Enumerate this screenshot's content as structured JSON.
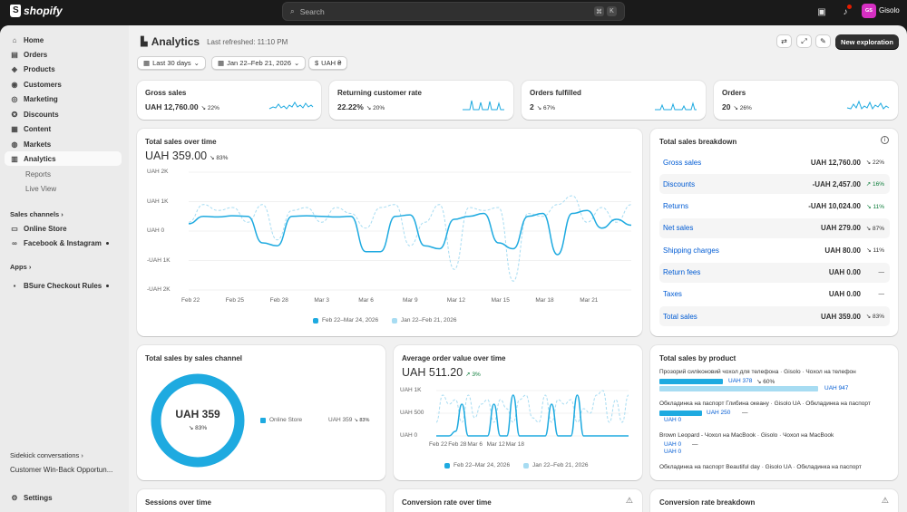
{
  "topbar": {
    "brand": "shopify",
    "search_placeholder": "Search",
    "kbd1": "⌘",
    "kbd2": "K",
    "avatar_initials": "GS",
    "store": "Gisolo",
    "notification_count": "1"
  },
  "sidebar": {
    "items": [
      {
        "label": "Home",
        "icon": "home-icon"
      },
      {
        "label": "Orders",
        "icon": "orders-icon"
      },
      {
        "label": "Products",
        "icon": "tag-icon"
      },
      {
        "label": "Customers",
        "icon": "person-icon"
      },
      {
        "label": "Marketing",
        "icon": "target-icon"
      },
      {
        "label": "Discounts",
        "icon": "discount-icon"
      },
      {
        "label": "Content",
        "icon": "content-icon"
      },
      {
        "label": "Markets",
        "icon": "globe-icon"
      },
      {
        "label": "Analytics",
        "icon": "chart-icon"
      }
    ],
    "sub_items": [
      "Reports",
      "Live View"
    ],
    "sales_channels_label": "Sales channels",
    "channels": [
      "Online Store",
      "Facebook & Instagram"
    ],
    "apps_label": "Apps",
    "apps": [
      "BSure Checkout Rules"
    ],
    "sidekick_label": "Sidekick conversations",
    "sidekick_item": "Customer Win-Back Opportun...",
    "settings": "Settings"
  },
  "header": {
    "title": "Analytics",
    "refreshed": "Last refreshed: 11:10 PM",
    "new_exploration": "New exploration"
  },
  "filters": {
    "range": "Last 30 days",
    "dates": "Jan 22–Feb 21, 2026",
    "currency": "UAH ₴"
  },
  "kpis": [
    {
      "title": "Gross sales",
      "value": "UAH 12,760.00",
      "pct": "↘ 22%"
    },
    {
      "title": "Returning customer rate",
      "value": "22.22%",
      "pct": "↘ 20%"
    },
    {
      "title": "Orders fulfilled",
      "value": "2",
      "pct": "↘ 67%"
    },
    {
      "title": "Orders",
      "value": "20",
      "pct": "↘ 26%"
    }
  ],
  "total_sales_chart": {
    "title": "Total sales over time",
    "value": "UAH 359.00",
    "pct": "↘ 83%",
    "legend": [
      "Feb 22–Mar 24, 2026",
      "Jan 22–Feb 21, 2026"
    ]
  },
  "chart_data": [
    {
      "type": "line",
      "title": "Total sales over time",
      "y_ticks": [
        "UAH 2K",
        "UAH 1K",
        "UAH 0",
        "-UAH 1K",
        "-UAH 2K"
      ],
      "x_ticks": [
        "Feb 22",
        "Feb 25",
        "Feb 28",
        "Mar 3",
        "Mar 6",
        "Mar 9",
        "Mar 12",
        "Mar 15",
        "Mar 18",
        "Mar 21"
      ],
      "ylim": [
        -2000,
        2000
      ],
      "series": [
        {
          "name": "Feb 22–Mar 24, 2026",
          "values": [
            250,
            500,
            480,
            520,
            500,
            -400,
            -500,
            500,
            520,
            500,
            480,
            500,
            -700,
            -700,
            500,
            550,
            -500,
            -600,
            400,
            500,
            600,
            -400,
            -600,
            500,
            600,
            -800,
            600,
            700,
            100,
            400,
            200
          ]
        },
        {
          "name": "Jan 22–Feb 21, 2026",
          "values": [
            300,
            900,
            700,
            800,
            300,
            900,
            -300,
            700,
            800,
            300,
            800,
            600,
            100,
            800,
            900,
            -500,
            300,
            900,
            -1300,
            800,
            700,
            800,
            -1700,
            600,
            500,
            900,
            1200,
            300,
            800,
            300,
            900
          ]
        }
      ]
    },
    {
      "type": "line",
      "title": "Average order value over time",
      "y_ticks": [
        "UAH 1K",
        "UAH 500",
        "UAH 0"
      ],
      "x_ticks": [
        "Feb 22",
        "Feb 28",
        "Mar 6",
        "Mar 12",
        "Mar 18"
      ],
      "ylim": [
        0,
        1000
      ],
      "series": [
        {
          "name": "Feb 22–Mar 24, 2026",
          "values": [
            0,
            0,
            0,
            100,
            700,
            0,
            0,
            0,
            0,
            700,
            0,
            0,
            900,
            0,
            0,
            0,
            0,
            0,
            700,
            0,
            0,
            0,
            900,
            0,
            0,
            0,
            0,
            0,
            0,
            0,
            0
          ]
        },
        {
          "name": "Jan 22–Feb 21, 2026",
          "values": [
            300,
            900,
            700,
            800,
            300,
            900,
            400,
            700,
            800,
            300,
            800,
            600,
            300,
            800,
            900,
            400,
            300,
            900,
            300,
            800,
            700,
            800,
            300,
            600,
            500,
            900,
            1000,
            300,
            800,
            300,
            900
          ]
        }
      ]
    },
    {
      "type": "pie",
      "title": "Total sales by sales channel",
      "center_value": "UAH 359",
      "center_pct": "↘ 83%",
      "series": [
        {
          "name": "Online Store",
          "values": [
            359
          ]
        }
      ]
    }
  ],
  "breakdown": {
    "title": "Total sales breakdown",
    "rows": [
      {
        "label": "Gross sales",
        "value": "UAH 12,760.00",
        "pct": "↘ 22%",
        "pct_color": "#303030"
      },
      {
        "label": "Discounts",
        "value": "-UAH 2,457.00",
        "pct": "↗ 16%",
        "pct_color": "#0c7d3a"
      },
      {
        "label": "Returns",
        "value": "-UAH 10,024.00",
        "pct": "↘ 11%",
        "pct_color": "#0c7d3a"
      },
      {
        "label": "Net sales",
        "value": "UAH 279.00",
        "pct": "↘ 87%",
        "pct_color": "#303030"
      },
      {
        "label": "Shipping charges",
        "value": "UAH 80.00",
        "pct": "↘ 11%",
        "pct_color": "#303030"
      },
      {
        "label": "Return fees",
        "value": "UAH 0.00",
        "pct": "—",
        "pct_color": "#303030"
      },
      {
        "label": "Taxes",
        "value": "UAH 0.00",
        "pct": "—",
        "pct_color": "#303030"
      },
      {
        "label": "Total sales",
        "value": "UAH 359.00",
        "pct": "↘ 83%",
        "pct_color": "#303030"
      }
    ]
  },
  "channel_card": {
    "title": "Total sales by sales channel",
    "center": "UAH 359",
    "center_pct": "↘ 83%",
    "legend_label": "Online Store",
    "legend_value": "UAH 359",
    "legend_pct": "↘ 83%"
  },
  "aov_card": {
    "title": "Average order value over time",
    "value": "UAH 511.20",
    "pct": "↗ 3%",
    "legend": [
      "Feb 22–Mar 24, 2026",
      "Jan 22–Feb 21, 2026"
    ]
  },
  "product_card": {
    "title": "Total sales by product",
    "products": [
      {
        "name": "Прозорий силіконовий чохол для телефона · Gisolo · Чохол на телефон",
        "cur": "UAH 378",
        "pct": "↘ 60%",
        "prev": "UAH 947",
        "cur_frac": 0.265,
        "prev_frac": 0.66
      },
      {
        "name": "Обкладинка на паспорт Глибина океану · Gisolo UA · Обкладинка на паспорт",
        "cur": "UAH 250",
        "pct": "—",
        "prev": "UAH 0",
        "cur_frac": 0.175,
        "prev_frac": 0
      },
      {
        "name": "Brown Leopard - Чохол на MacBook · Gisolo · Чохол на MacBook",
        "cur": "UAH 0",
        "pct": "—",
        "prev": "UAH 0",
        "cur_frac": 0,
        "prev_frac": 0
      },
      {
        "name": "Обкладинка на паспорт Beautiful day · Gisolo UA · Обкладинка на паспорт",
        "cur": "",
        "pct": "",
        "prev": "",
        "cur_frac": 0,
        "prev_frac": 0
      }
    ]
  },
  "bottom_cards": [
    "Sessions over time",
    "Conversion rate over time",
    "Conversion rate breakdown"
  ],
  "colors": {
    "accent": "#1eaae0",
    "accent_light": "#a7dcf2",
    "link": "#005bd3"
  }
}
